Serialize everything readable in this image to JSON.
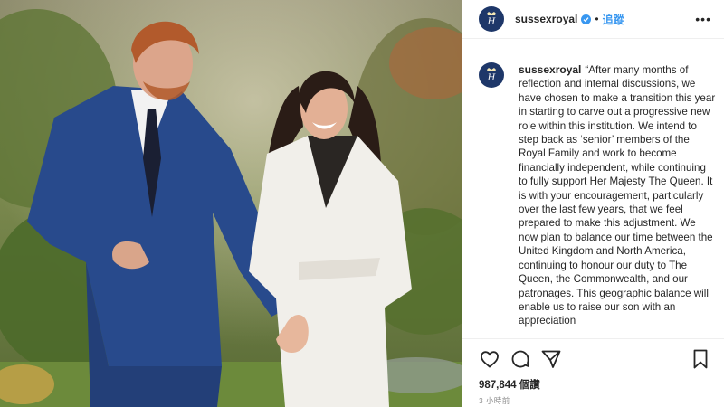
{
  "post": {
    "username": "sussexroyal",
    "follow_label": "追蹤",
    "dot": "•",
    "more_label": "•••",
    "caption": "“After many months of reflection and internal discussions, we have chosen to make a transition this year in starting to carve out a progressive new role within this institution. We intend to step back as ‘senior’ members of the Royal Family and work to become financially independent, while continuing to fully support Her Majesty The Queen. It is with your encouragement, particularly over the last few years, that we feel prepared to make this adjustment. We now plan to balance our time between the United Kingdom and North America, continuing to honour our duty to The Queen, the Commonwealth, and our patronages. This geographic balance will enable us to raise our son with an appreciation",
    "views": "987,844 個讚",
    "time": "3 小時前"
  },
  "icons": {
    "avatar": "royal-monogram-icon",
    "verified": "verified-badge-icon",
    "like": "heart-icon",
    "comment": "comment-icon",
    "share": "paper-plane-icon",
    "save": "bookmark-icon",
    "more": "more-options-icon"
  },
  "colors": {
    "accent": "#3897f0",
    "avatar_bg": "#1e3769",
    "text": "#262626",
    "muted": "#8e8e8e"
  }
}
